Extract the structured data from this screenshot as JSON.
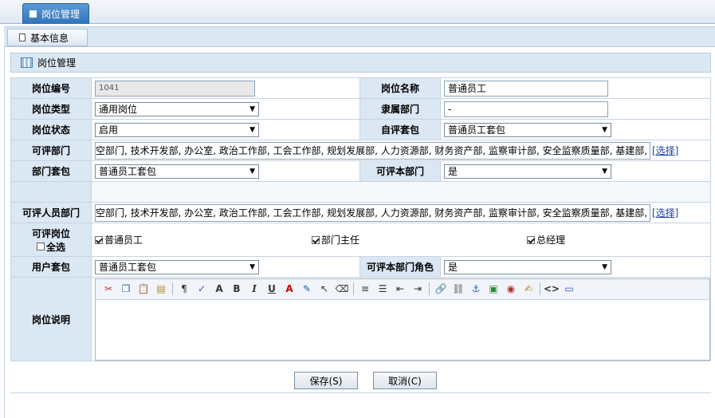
{
  "header": {
    "tab_label": "岗位管理"
  },
  "subheader": {
    "tab_label": "基本信息"
  },
  "section": {
    "title": "岗位管理"
  },
  "form": {
    "post_code": {
      "label": "岗位编号",
      "value": "1041"
    },
    "post_name": {
      "label": "岗位名称",
      "value": "普通员工"
    },
    "post_type": {
      "label": "岗位类型",
      "value": "通用岗位"
    },
    "department": {
      "label": "隶属部门",
      "value": "-"
    },
    "post_status": {
      "label": "岗位状态",
      "value": "启用"
    },
    "self_eval_pkg": {
      "label": "自评套包",
      "value": "普通员工套包"
    },
    "eval_depts": {
      "label": "可评部门",
      "value": "空部门, 技术开发部, 办公室, 政治工作部, 工会工作部, 规划发展部, 人力资源部, 财务资产部, 监察审计部, 安全监察质量部, 基建部, 运维",
      "choose": "[选择]"
    },
    "dept_pkg": {
      "label": "部门套包",
      "value": "普通员工套包"
    },
    "eval_own_dept": {
      "label": "可评本部门",
      "value": "是"
    },
    "eval_staff_depts": {
      "label": "可评人员部门",
      "value": "空部门, 技术开发部, 办公室, 政治工作部, 工会工作部, 规划发展部, 人力资源部, 财务资产部, 监察审计部, 安全监察质量部, 基建部, 运维",
      "choose": "[选择]"
    },
    "eval_posts": {
      "label": "可评岗位",
      "select_all": "全选",
      "options": [
        "普通员工",
        "部门主任",
        "总经理"
      ]
    },
    "user_pkg": {
      "label": "用户套包",
      "value": "普通员工套包"
    },
    "eval_own_dept_role": {
      "label": "可评本部门角色",
      "value": "是"
    },
    "description": {
      "label": "岗位说明",
      "value": ""
    }
  },
  "buttons": {
    "save": "保存(S)",
    "cancel": "取消(C)"
  },
  "colors": {
    "accent": "#2f73b9",
    "label_bg": "#dbe7f3",
    "border": "#c6d3e0"
  }
}
